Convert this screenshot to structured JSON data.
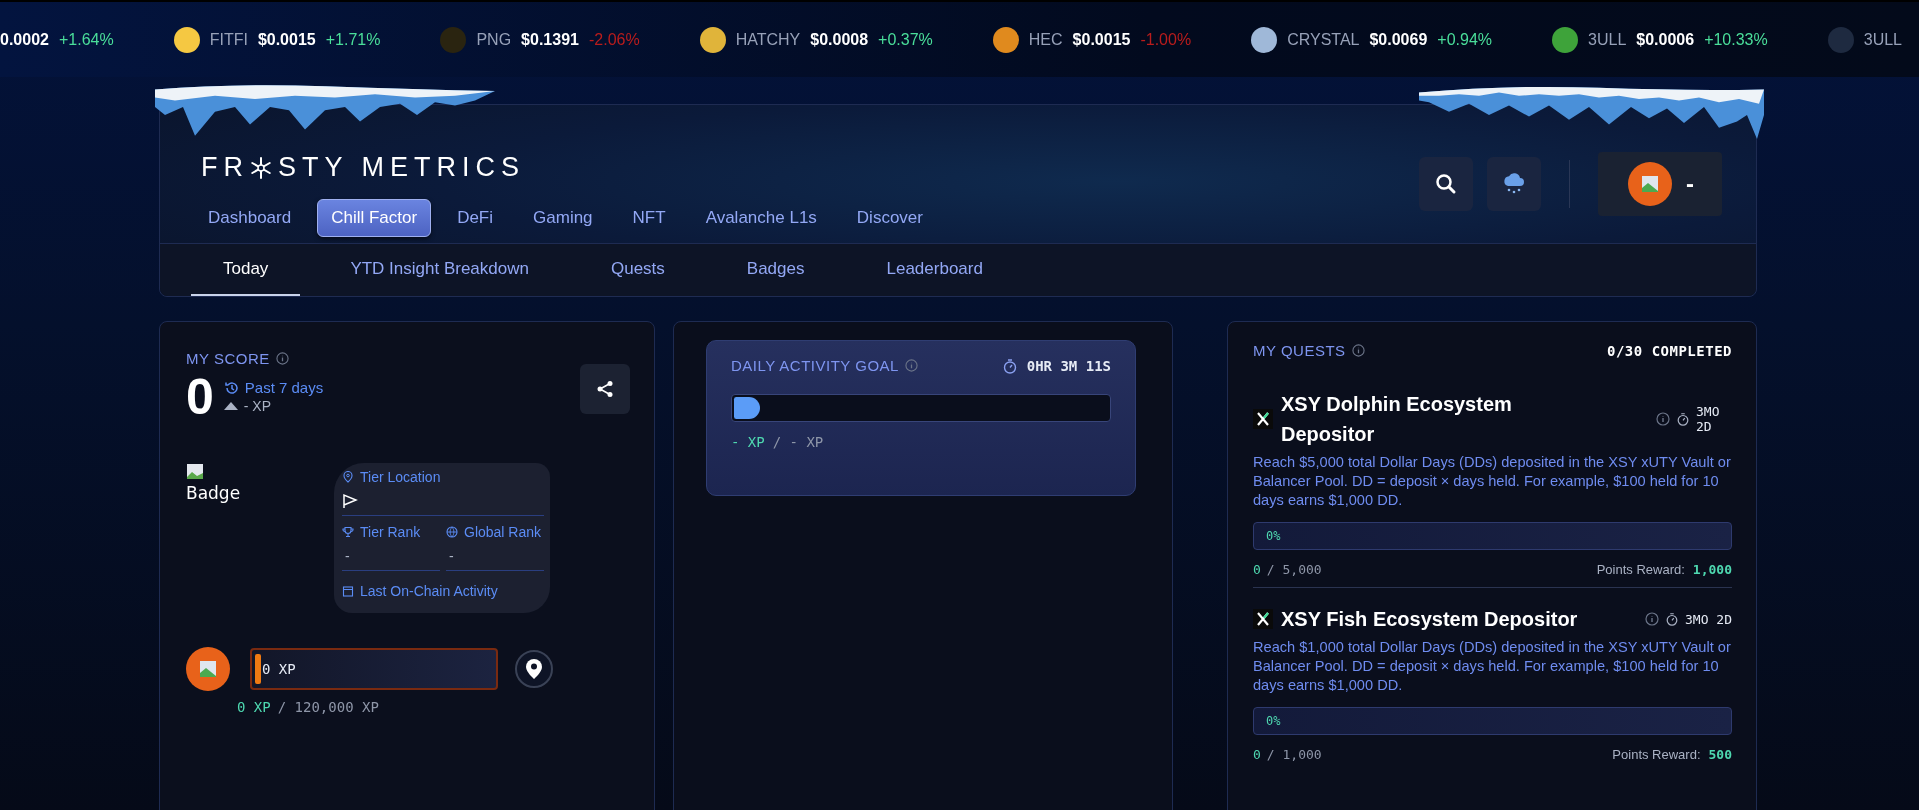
{
  "ticker": [
    {
      "price": "0.0002",
      "change": "+1.64%",
      "negative": false
    },
    {
      "symbol": "FITFI",
      "price": "$0.0015",
      "change": "+1.71%",
      "negative": false,
      "color": "#f5c842"
    },
    {
      "symbol": "PNG",
      "price": "$0.1391",
      "change": "-2.06%",
      "negative": true,
      "color": "#2a2410"
    },
    {
      "symbol": "HATCHY",
      "price": "$0.0008",
      "change": "+0.37%",
      "negative": false,
      "color": "#e0b43a"
    },
    {
      "symbol": "HEC",
      "price": "$0.0015",
      "change": "-1.00%",
      "negative": true,
      "color": "#e08a1e"
    },
    {
      "symbol": "CRYSTAL",
      "price": "$0.0069",
      "change": "+0.94%",
      "negative": false,
      "color": "#9fb8d8"
    },
    {
      "symbol": "3ULL",
      "price": "$0.0006",
      "change": "+10.33%",
      "negative": false,
      "color": "#3ea33a"
    },
    {
      "symbol": "3ULL",
      "color": "#1e2a40"
    }
  ],
  "header": {
    "logo": {
      "before": "FR",
      "after": "STY METRICS"
    },
    "nav": [
      {
        "label": "Dashboard",
        "selected": false
      },
      {
        "label": "Chill Factor",
        "selected": true
      },
      {
        "label": "DeFi",
        "selected": false
      },
      {
        "label": "Gaming",
        "selected": false
      },
      {
        "label": "NFT",
        "selected": false
      },
      {
        "label": "Avalanche L1s",
        "selected": false
      },
      {
        "label": "Discover",
        "selected": false
      }
    ],
    "user": {
      "name": "-"
    },
    "subtabs": [
      {
        "label": "Today",
        "selected": true
      },
      {
        "label": "YTD Insight Breakdown",
        "selected": false
      },
      {
        "label": "Quests",
        "selected": false
      },
      {
        "label": "Badges",
        "selected": false
      },
      {
        "label": "Leaderboard",
        "selected": false
      }
    ]
  },
  "score": {
    "title": "MY SCORE",
    "value": "0",
    "period": "Past 7 days",
    "change": "- XP",
    "badge_alt": "Badge",
    "tier_location": {
      "label": "Tier Location"
    },
    "ranks": [
      {
        "kind": "trophy",
        "label": "Tier Rank",
        "value": "-"
      },
      {
        "kind": "globe",
        "label": "Global Rank",
        "value": "-"
      }
    ],
    "last_activity": {
      "label": "Last On-Chain Activity"
    },
    "xp_bar": {
      "label": "0 XP",
      "level": 0
    },
    "xp_current": "0 XP",
    "xp_total": "/ 120,000 XP"
  },
  "daily_goal": {
    "title": "DAILY ACTIVITY GOAL",
    "timer": "0HR 3M 11S",
    "level": 0,
    "current": "- XP",
    "total": "/ - XP"
  },
  "quests": {
    "title": "MY QUESTS",
    "completed": "0/30 COMPLETED",
    "items": [
      {
        "title": "XSY Dolphin Ecosystem Depositor",
        "duration": "3MO 2D",
        "description": "Reach $5,000 total Dollar Days (DDs) deposited in the XSY xUTY Vault or Balancer Pool. DD = deposit × days held. For example, $100 held for 10 days earns $1,000 DD.",
        "progress_label": "0%",
        "level": 0,
        "current": "0",
        "total": "/ 5,000",
        "reward_label": "Points Reward:",
        "reward": "1,000"
      },
      {
        "title": "XSY Fish Ecosystem Depositor",
        "duration": "3MO 2D",
        "description": "Reach $1,000 total Dollar Days (DDs) deposited in the XSY xUTY Vault or Balancer Pool. DD = deposit × days held. For example, $100 held for 10 days earns $1,000 DD.",
        "progress_label": "0%",
        "level": 0,
        "current": "0",
        "total": "/ 1,000",
        "reward_label": "Points Reward:",
        "reward": "500"
      }
    ]
  }
}
